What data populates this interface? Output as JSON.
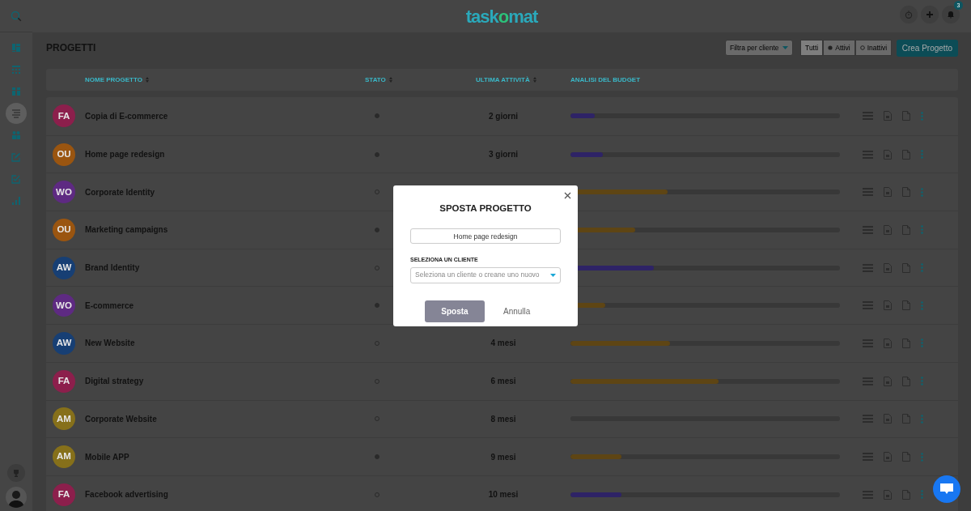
{
  "header": {
    "logo": [
      "task",
      "o",
      "mat"
    ],
    "notification_count": "3"
  },
  "sidebar": {
    "items": [
      {
        "kind": "dashboard",
        "selected": false
      },
      {
        "kind": "calendar",
        "selected": false
      },
      {
        "kind": "boards",
        "selected": false
      },
      {
        "kind": "list",
        "selected": true
      },
      {
        "kind": "team",
        "selected": false
      },
      {
        "kind": "edit",
        "selected": false
      },
      {
        "kind": "check",
        "selected": false
      },
      {
        "kind": "chart",
        "selected": false
      }
    ]
  },
  "page": {
    "title": "PROGETTI",
    "client_filter": {
      "placeholder": "Filtra per cliente"
    },
    "status_filter": [
      {
        "label": "Tutti",
        "kind": "all",
        "selected": true
      },
      {
        "label": "Attivi",
        "kind": "active",
        "selected": false
      },
      {
        "label": "Inattivi",
        "kind": "inactive",
        "selected": false
      }
    ],
    "create_button": "Crea Progetto"
  },
  "table": {
    "columns": [
      {
        "label": "NOME PROGETTO",
        "sortable": true
      },
      {
        "label": "STATO",
        "sortable": true
      },
      {
        "label": "ULTIMA ATTIVITÀ",
        "sortable": true
      },
      {
        "label": "ANALISI DEL BUDGET",
        "sortable": false
      }
    ],
    "rows": [
      {
        "initials": "FA",
        "color": "#8c1f4c",
        "name": "Copia di E-commerce",
        "active": true,
        "last_activity": "2 giorni",
        "budget": {
          "level": 0.09,
          "color": "#2e2366"
        }
      },
      {
        "initials": "OU",
        "color": "#9a5510",
        "name": "Home page redesign",
        "active": true,
        "last_activity": "3 giorni",
        "budget": {
          "level": 0.12,
          "color": "#2e2366"
        }
      },
      {
        "initials": "WO",
        "color": "#5e2a82",
        "name": "Corporate Identity",
        "active": false,
        "budget": {
          "level": 0.36,
          "color": "#5e4514"
        }
      },
      {
        "initials": "OU",
        "color": "#9a5510",
        "name": "Marketing campaigns",
        "active": true,
        "budget": {
          "level": 0.24,
          "color": "#5e4514"
        }
      },
      {
        "initials": "AW",
        "color": "#173f74",
        "name": "Brand Identity",
        "active": false,
        "budget": {
          "level": 0.31,
          "color": "#2e2366"
        }
      },
      {
        "initials": "WO",
        "color": "#5e2a82",
        "name": "E-commerce",
        "active": true,
        "budget": {
          "level": 0.13,
          "color": "#5e4514"
        }
      },
      {
        "initials": "AW",
        "color": "#173f74",
        "name": "New Website",
        "active": false,
        "last_activity": "4 mesi",
        "budget": {
          "level": 0.37,
          "color": "#5e4514"
        }
      },
      {
        "initials": "FA",
        "color": "#8c1f4c",
        "name": "Digital strategy",
        "active": false,
        "last_activity": "6 mesi",
        "budget": {
          "level": 0.55,
          "color": "#5e4514"
        }
      },
      {
        "initials": "AM",
        "color": "#86701a",
        "name": "Corporate Website",
        "active": false,
        "last_activity": "8 mesi",
        "budget": {
          "level": 0
        }
      },
      {
        "initials": "AM",
        "color": "#86701a",
        "name": "Mobile APP",
        "active": true,
        "last_activity": "9 mesi",
        "budget": {
          "level": 0.19,
          "color": "#5e4514"
        }
      },
      {
        "initials": "FA",
        "color": "#8c1f4c",
        "name": "Facebook advertising",
        "active": false,
        "last_activity": "10 mesi",
        "budget": {
          "level": 0.19,
          "color": "#2e2366"
        }
      }
    ]
  },
  "modal": {
    "title": "SPOSTA PROGETTO",
    "project_name": "Home page redesign",
    "client_label": "SELEZIONA UN CLIENTE",
    "client_select": {
      "placeholder": "Seleziona un cliente o creane uno nuovo"
    },
    "confirm_button": "Sposta",
    "cancel_button": "Annulla"
  }
}
